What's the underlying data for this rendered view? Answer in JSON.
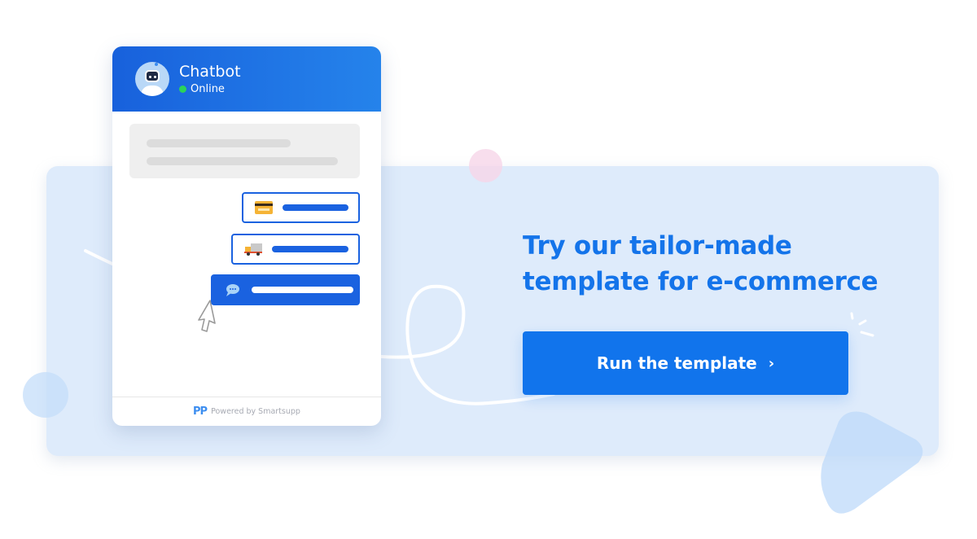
{
  "chat_widget": {
    "title": "Chatbot",
    "status": "Online",
    "status_color": "#2bd35a",
    "header_gradient": [
      "#1861dc",
      "#2583eb"
    ],
    "options": [
      {
        "icon": "credit-card-icon",
        "style": "outlined"
      },
      {
        "icon": "delivery-truck-icon",
        "style": "outlined"
      },
      {
        "icon": "speech-bubble-icon",
        "style": "filled"
      }
    ],
    "footer": {
      "logo": "PP",
      "text": "Powered by Smartsupp"
    }
  },
  "cta": {
    "headline_line1": "Try our tailor-made",
    "headline_line2": "template for e-commerce",
    "button_label": "Run the template",
    "button_chevron": "›",
    "accent_color": "#1174ec",
    "headline_color": "#1474ea"
  },
  "banner": {
    "background_color": "#deebfb"
  }
}
